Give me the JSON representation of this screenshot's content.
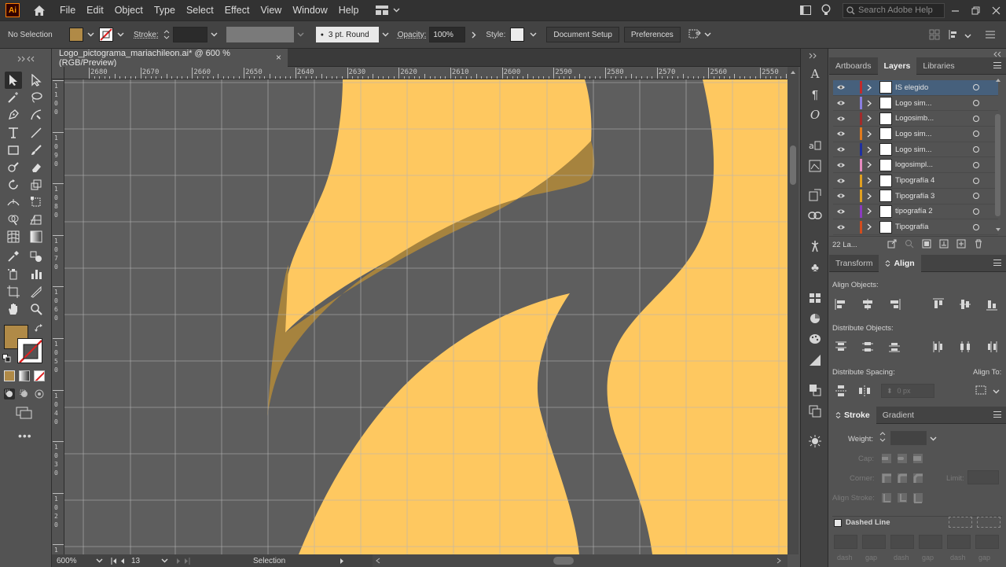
{
  "menubar": {
    "logo": "Ai",
    "items": [
      "File",
      "Edit",
      "Object",
      "Type",
      "Select",
      "Effect",
      "View",
      "Window",
      "Help"
    ],
    "search_placeholder": "Search Adobe Help"
  },
  "controlbar": {
    "selection_label": "No Selection",
    "fill_color": "#b08a47",
    "stroke_label": "Stroke:",
    "brush_label": "3 pt. Round",
    "opacity_label": "Opacity:",
    "opacity_value": "100%",
    "style_label": "Style:",
    "document_setup": "Document Setup",
    "preferences": "Preferences"
  },
  "document": {
    "tab_title": "Logo_pictograma_mariachileon.ai* @ 600 % (RGB/Preview)",
    "close_glyph": "×"
  },
  "ruler": {
    "h_labels": [
      "2680",
      "2670",
      "2660",
      "2650",
      "2640",
      "2630",
      "2620",
      "2610",
      "2600",
      "2590",
      "2580",
      "2570",
      "2560",
      "2550"
    ],
    "v_labels": [
      "1\n1\n0\n0",
      "1\n0\n9\n0",
      "1\n0\n8\n0",
      "1\n0\n7\n0",
      "1\n0\n6\n0",
      "1\n0\n5\n0",
      "1\n0\n4\n0",
      "1\n0\n3\n0",
      "1\n0\n2\n0",
      "1\n0\n1\n0"
    ]
  },
  "canvas": {
    "background": "#5e5e5e",
    "shape_color": "#fec860",
    "shadow_color": "#a6833e",
    "grid_color": "#b5b5b5"
  },
  "statusbar": {
    "zoom": "600%",
    "artboard_number": "13",
    "tool": "Selection"
  },
  "layers_panel": {
    "tabs": [
      "Artboards",
      "Layers",
      "Libraries"
    ],
    "active_tab": "Layers",
    "layers": [
      {
        "name": "IS elegido",
        "color": "#c22b2b",
        "selected": true
      },
      {
        "name": "Logo sim...",
        "color": "#8a7fe0",
        "selected": false
      },
      {
        "name": "Logosimb...",
        "color": "#a12a2a",
        "selected": false
      },
      {
        "name": "Logo sim...",
        "color": "#e07a1e",
        "selected": false
      },
      {
        "name": "Logo sim...",
        "color": "#1f2fa0",
        "selected": false
      },
      {
        "name": "logosimpl...",
        "color": "#e68ac0",
        "selected": false
      },
      {
        "name": "Tipografía 4",
        "color": "#e0a020",
        "selected": false
      },
      {
        "name": "Tipografía 3",
        "color": "#e0a020",
        "selected": false
      },
      {
        "name": "tipografía 2",
        "color": "#8a3bbf",
        "selected": false
      },
      {
        "name": "Tipografía",
        "color": "#d24c1e",
        "selected": false
      }
    ],
    "count_label": "22 La..."
  },
  "align_panel": {
    "tabs": [
      "Transform",
      "Align"
    ],
    "active_tab": "Align",
    "align_objects": "Align Objects:",
    "distribute_objects": "Distribute Objects:",
    "distribute_spacing": "Distribute Spacing:",
    "align_to": "Align To:",
    "spacing_value": "0 px"
  },
  "stroke_panel": {
    "tabs": [
      "Stroke",
      "Gradient"
    ],
    "active_tab": "Stroke",
    "weight_label": "Weight:",
    "cap_label": "Cap:",
    "corner_label": "Corner:",
    "limit_label": "Limit:",
    "align_stroke_label": "Align Stroke:",
    "dashed_line_label": "Dashed Line",
    "dash_labels": [
      "dash",
      "gap",
      "dash",
      "gap",
      "dash",
      "gap"
    ]
  }
}
